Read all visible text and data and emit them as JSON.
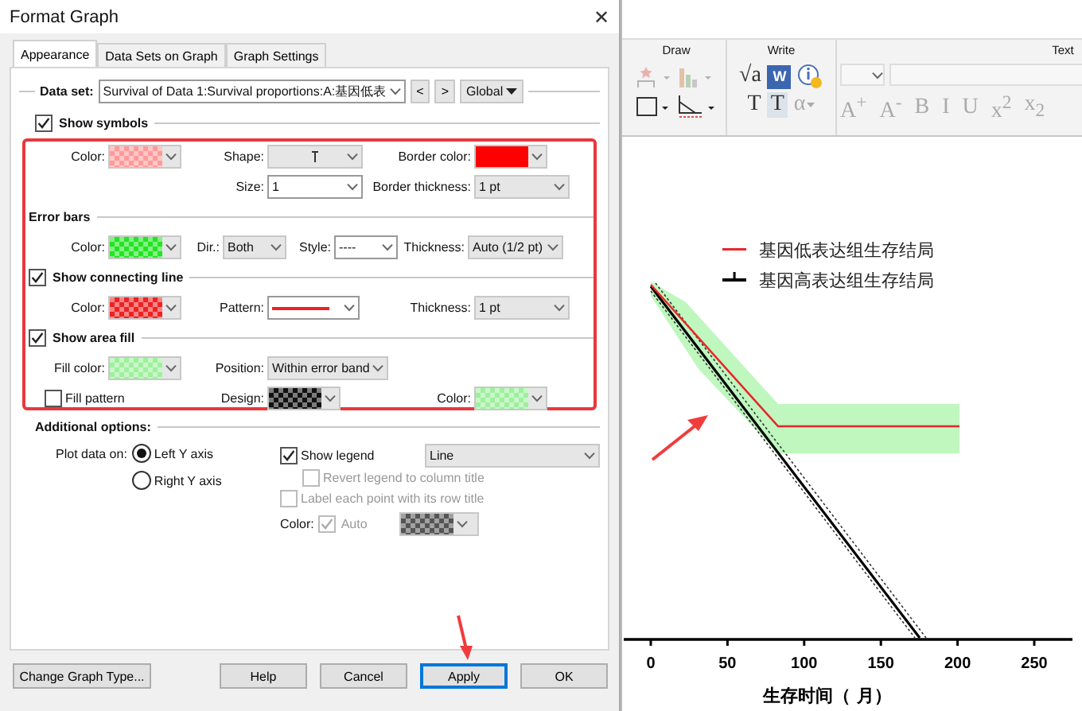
{
  "window": {
    "title": "Format Graph",
    "close": "✕"
  },
  "tabs": [
    {
      "label": "Appearance",
      "selected": true
    },
    {
      "label": "Data Sets on Graph",
      "selected": false
    },
    {
      "label": "Graph Settings",
      "selected": false
    }
  ],
  "data_set": {
    "label": "Data set:",
    "value": "Survival of Data 1:Survival proportions:A:基因低表",
    "prev": "<",
    "next": ">",
    "scope": "Global"
  },
  "symbols": {
    "title": "Show symbols",
    "checked": true
  },
  "sections": [
    {
      "rows": [
        [
          {
            "kind": "swatch",
            "label": "Color:",
            "color": "#ff9a9a",
            "checkered": true
          },
          {
            "kind": "shape",
            "label": "Shape:",
            "editable": false
          },
          {
            "kind": "swatch",
            "label": "Border color:",
            "color": "#ff0000",
            "checkered": false
          }
        ],
        [
          null,
          {
            "kind": "combo",
            "label": "Size:",
            "value": "1",
            "editable": true
          },
          {
            "kind": "combo",
            "label": "Border thickness:",
            "value": "1 pt",
            "editable": false
          }
        ]
      ]
    },
    {
      "title": "Error bars",
      "rows": [
        [
          {
            "kind": "swatch",
            "label": "Color:",
            "color": "#22e522",
            "checkered": true
          },
          {
            "kind": "combo",
            "label": "Dir.:",
            "value": "Both",
            "editable": false
          },
          {
            "kind": "combo",
            "label": "Style:",
            "value": "----",
            "editable": true
          },
          {
            "kind": "combo",
            "label": "Thickness:",
            "value": "Auto (1/2 pt)",
            "editable": false
          }
        ]
      ]
    },
    {
      "title": "Show connecting line",
      "checked": true,
      "rows": [
        [
          {
            "kind": "swatch",
            "label": "Color:",
            "color": "#ee2222",
            "checkered": true
          },
          {
            "kind": "line",
            "label": "Pattern:",
            "color": "#ee2222"
          },
          {
            "kind": "combo",
            "label": "Thickness:",
            "value": "1 pt",
            "editable": false
          }
        ]
      ]
    },
    {
      "title": "Show area fill",
      "checked": true,
      "rows": [
        [
          {
            "kind": "swatch",
            "label": "Fill color:",
            "color": "#9ef09e",
            "checkered": true
          },
          {
            "kind": "combo",
            "label": "Position:",
            "value": "Within error band",
            "editable": false
          },
          null
        ],
        [
          {
            "kind": "checkbox",
            "label": "Fill pattern",
            "checked": false
          },
          {
            "kind": "swatch",
            "label": "Design:",
            "color": "#111111",
            "checkered": true
          },
          {
            "kind": "swatch",
            "label": "Color:",
            "color": "#9ef09e",
            "checkered": true
          }
        ]
      ]
    }
  ],
  "additional": {
    "title": "Additional options:",
    "plot_label": "Plot data on:",
    "axes": [
      {
        "label": "Left Y axis",
        "selected": true
      },
      {
        "label": "Right  Y axis",
        "selected": false
      }
    ],
    "show_legend": {
      "label": "Show legend",
      "checked": true,
      "style": "Line"
    },
    "options": [
      {
        "label": "Revert legend to column title",
        "checked": false,
        "disabled": true
      },
      {
        "label": "Label each point with its row title",
        "checked": false,
        "disabled": true
      }
    ],
    "color": {
      "label": "Color:",
      "auto_label": "Auto",
      "auto_checked": true,
      "disabled": true
    }
  },
  "buttons": [
    {
      "label": "Change Graph Type...",
      "default": false
    },
    {
      "label": "Help",
      "default": false
    },
    {
      "label": "Cancel",
      "default": false
    },
    {
      "label": "Apply",
      "default": true
    },
    {
      "label": "OK",
      "default": false
    }
  ],
  "ribbon": [
    {
      "title": "Draw",
      "tools": [
        {
          "kind": "star",
          "disabled": true
        },
        {
          "kind": "chart",
          "disabled": true
        },
        {
          "kind": "rect",
          "disabled": false
        },
        {
          "kind": "angle",
          "disabled": false
        }
      ]
    },
    {
      "title": "Write",
      "tools": [
        {
          "kind": "glyph",
          "text": "√a",
          "disabled": false
        },
        {
          "kind": "tile",
          "text": "W",
          "disabled": false
        },
        {
          "kind": "info",
          "disabled": false
        },
        {
          "kind": "glyph",
          "text": "T",
          "disabled": false
        },
        {
          "kind": "boxglyph",
          "text": "T",
          "disabled": false
        },
        {
          "kind": "glyph",
          "text": "α",
          "menu": true,
          "disabled": true
        }
      ]
    },
    {
      "title": "Text",
      "tools": [
        {
          "kind": "glyph",
          "text": "A$^{+}$",
          "disabled": true
        },
        {
          "kind": "glyph",
          "text": "A$^{-}$",
          "disabled": true
        },
        {
          "kind": "glyph",
          "text": "B",
          "disabled": true
        },
        {
          "kind": "glyph",
          "text": "I",
          "disabled": true
        },
        {
          "kind": "glyph",
          "text": "U",
          "disabled": true
        },
        {
          "kind": "glyph",
          "text": "x$^{2}$",
          "disabled": true
        },
        {
          "kind": "glyph",
          "text": "x$_{2}$",
          "disabled": true
        }
      ]
    }
  ],
  "graph": {
    "legend": [
      {
        "name": "基因低表达组生存结局",
        "color": "#e8262b",
        "kind": "line"
      },
      {
        "name": "基因高表达组生存结局",
        "color": "#000000",
        "kind": "tick"
      }
    ],
    "x_ticks": [
      "0",
      "50",
      "100",
      "150",
      "200",
      "250"
    ],
    "x_label": "生存时间（ 月）"
  }
}
